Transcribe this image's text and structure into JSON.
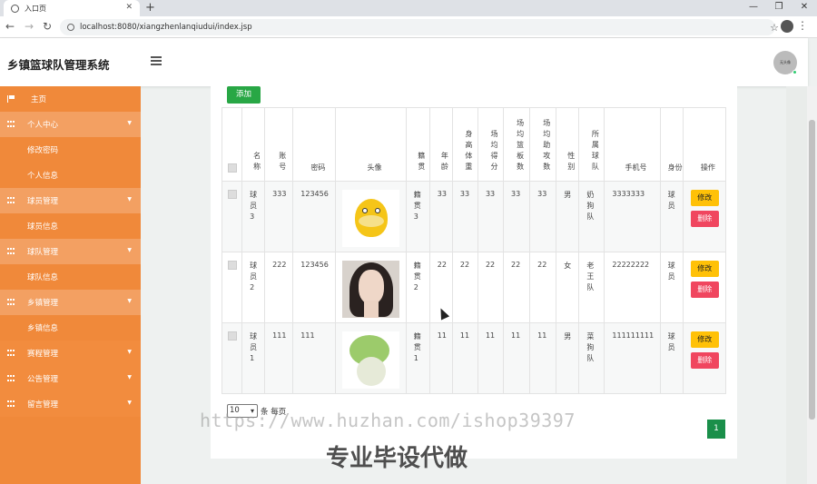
{
  "browser": {
    "tab_title": "入口页",
    "url": "localhost:8080/xiangzhenlanqiudui/index.jsp"
  },
  "app": {
    "title": "乡镇篮球队管理系统",
    "avatar_text": "无头像"
  },
  "sidebar": {
    "items": [
      {
        "label": "主页",
        "type": "top",
        "icon": "flag-icon"
      },
      {
        "label": "个人中心",
        "type": "parent",
        "icon": "grid-icon"
      },
      {
        "label": "修改密码",
        "type": "sub"
      },
      {
        "label": "个人信息",
        "type": "sub"
      },
      {
        "label": "球员管理",
        "type": "parent",
        "icon": "grid-icon"
      },
      {
        "label": "球员信息",
        "type": "sub"
      },
      {
        "label": "球队管理",
        "type": "parent",
        "icon": "grid-icon"
      },
      {
        "label": "球队信息",
        "type": "sub"
      },
      {
        "label": "乡镇管理",
        "type": "parent",
        "icon": "grid-icon"
      },
      {
        "label": "乡镇信息",
        "type": "sub"
      },
      {
        "label": "赛程管理",
        "type": "parent",
        "icon": "grid-icon"
      },
      {
        "label": "公告管理",
        "type": "parent",
        "icon": "grid-icon"
      },
      {
        "label": "留言管理",
        "type": "parent",
        "icon": "grid-icon"
      }
    ]
  },
  "main": {
    "add_label": "添加",
    "columns": [
      "名称",
      "账号",
      "密码",
      "头像",
      "籍贯",
      "年龄",
      "身高体重",
      "场均得分",
      "场均篮板数",
      "场均助攻数",
      "性别",
      "所属球队",
      "手机号",
      "身份",
      "操作"
    ],
    "rows": [
      {
        "name": "球员3",
        "account": "333",
        "password": "123456",
        "avatar": "duck",
        "native": "籍贯3",
        "age": "33",
        "hw": "33",
        "pts": "33",
        "reb": "33",
        "ast": "33",
        "gender": "男",
        "team": "奶狗队",
        "phone": "3333333",
        "role": "球员"
      },
      {
        "name": "球员2",
        "account": "222",
        "password": "123456",
        "avatar": "face",
        "native": "籍贯2",
        "age": "22",
        "hw": "22",
        "pts": "22",
        "reb": "22",
        "ast": "22",
        "gender": "女",
        "team": "老王队",
        "phone": "22222222",
        "role": "球员"
      },
      {
        "name": "球员1",
        "account": "111",
        "password": "111",
        "avatar": "cabbage",
        "native": "籍贯1",
        "age": "11",
        "hw": "11",
        "pts": "11",
        "reb": "11",
        "ast": "11",
        "gender": "男",
        "team": "菜狗队",
        "phone": "111111111",
        "role": "球员"
      }
    ],
    "edit_label": "修改",
    "delete_label": "删除",
    "page_size": "10",
    "page_size_suffix": "条 每页",
    "current_page": "1"
  },
  "watermark": {
    "url_text": "https://www.huzhan.com/ishop39397",
    "caption": "专业毕设代做"
  },
  "colors": {
    "sidebar": "#f0893a",
    "add_button": "#28a745",
    "edit_button": "#ffc107",
    "delete_button": "#f0465f",
    "page_active": "#1a8f4a"
  }
}
